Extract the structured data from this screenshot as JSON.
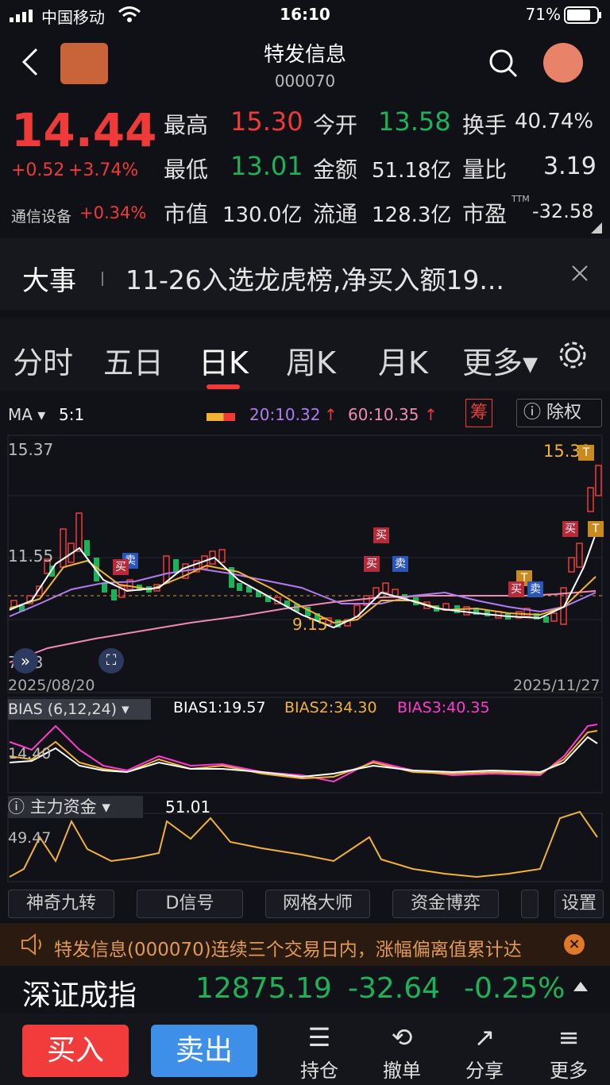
{
  "status": {
    "carrier": "中国移动",
    "time": "16:10",
    "battery": "71%"
  },
  "header": {
    "title": "特发信息",
    "code": "000070"
  },
  "quote": {
    "price": "14.44",
    "change": "+0.52",
    "change_pct": "+3.74%",
    "sector": "通信设备",
    "sector_pct": "+0.34%",
    "high_label": "最高",
    "high": "15.30",
    "open_label": "今开",
    "open": "13.58",
    "turnover_label": "换手",
    "turnover": "40.74%",
    "low_label": "最低",
    "low": "13.01",
    "amount_label": "金额",
    "amount": "51.18亿",
    "vol_ratio_label": "量比",
    "vol_ratio": "3.19",
    "mktcap_label": "市值",
    "mktcap": "130.0亿",
    "float_label": "流通",
    "float_cap": "128.3亿",
    "pe_label": "市盈",
    "pe_sup": "TTM",
    "pe": "-32.58"
  },
  "news": {
    "tag": "大事",
    "text": "11-26入选龙虎榜,净买入额19..."
  },
  "tabs": [
    {
      "label": "分时"
    },
    {
      "label": "五日"
    },
    {
      "label": "日K"
    },
    {
      "label": "周K"
    },
    {
      "label": "月K"
    },
    {
      "label": "更多▾"
    }
  ],
  "chart": {
    "ma_label": "MA ▾",
    "ma5": "5:1",
    "ma20": "20:10.32",
    "ma60": "60:10.35",
    "chip_label": "筹",
    "adjust_label": "除权",
    "y_top": "15.37",
    "y_mid": "11.55",
    "y_bot": "7.73",
    "low_mark": "9.15",
    "high_mark": "15.30",
    "date_start": "2025/08/20",
    "date_end": "2025/11/27",
    "bias_label": "BIAS (6,12,24)",
    "bias1": "BIAS1:19.57",
    "bias2": "BIAS2:34.30",
    "bias3": "BIAS3:40.35",
    "bias_y": "14.40",
    "fund_label": "主力资金",
    "fund_val": "51.01",
    "fund_y": "49.47",
    "markers": {
      "buy": "买",
      "sell": "卖",
      "t": "T"
    }
  },
  "chart_data": {
    "type": "candlestick",
    "title": "日K",
    "ylim": [
      7.73,
      15.37
    ],
    "x_range": [
      "2025/08/20",
      "2025/11/27"
    ],
    "ma_values": {
      "MA20": 10.32,
      "MA60": 10.35
    },
    "annotated_low": 9.15,
    "annotated_high": 15.3
  },
  "buttons": [
    {
      "label": "神奇九转"
    },
    {
      "label": "D信号"
    },
    {
      "label": "网格大师"
    },
    {
      "label": "资金博弈"
    },
    {
      "label": "设置"
    }
  ],
  "notice": {
    "text": "特发信息(000070)连续三个交易日内，涨幅偏离值累计达"
  },
  "index": {
    "name": "深证成指",
    "value": "12875.19",
    "change": "-32.64",
    "pct": "-0.25%"
  },
  "bottom": {
    "buy": "买入",
    "sell": "卖出",
    "hold": "持仓",
    "cancel": "撤单",
    "share": "分享",
    "more": "更多"
  },
  "colors": {
    "up": "#f03a3a",
    "down": "#1ab35a",
    "ma5": "#ffffff",
    "ma10": "#f2b233",
    "ma20": "#b07cf0",
    "ma60": "#f08ab3"
  }
}
